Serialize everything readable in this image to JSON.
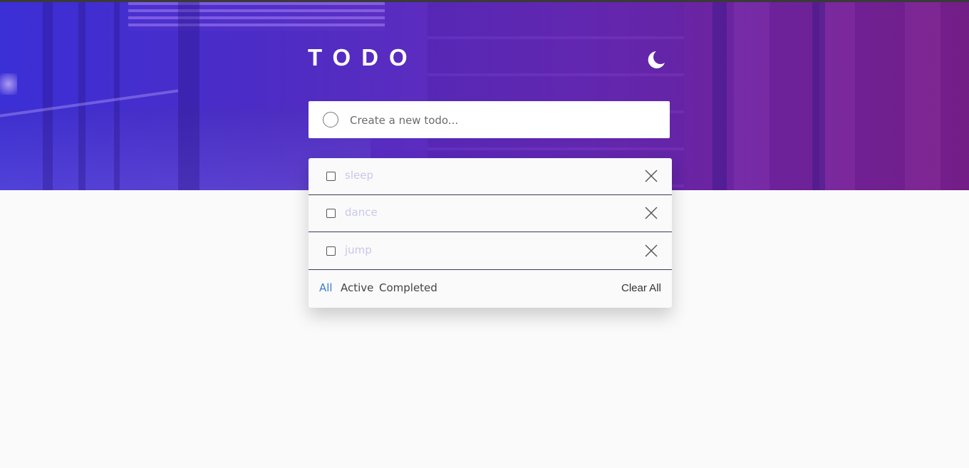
{
  "header": {
    "title": "TODO",
    "theme_icon": "moon-icon"
  },
  "new_todo": {
    "placeholder": "Create a new todo...",
    "value": ""
  },
  "todos": [
    {
      "label": "sleep",
      "completed": false
    },
    {
      "label": "dance",
      "completed": false
    },
    {
      "label": "jump",
      "completed": false
    }
  ],
  "footer": {
    "filters": [
      "All",
      "Active",
      "Completed"
    ],
    "active_filter": "All",
    "clear_label": "Clear All"
  },
  "colors": {
    "accent": "#3a7bd5",
    "gradient_start": "#3b2fd6",
    "gradient_end": "#7a1f8a",
    "todo_text": "#c9c8ea"
  }
}
